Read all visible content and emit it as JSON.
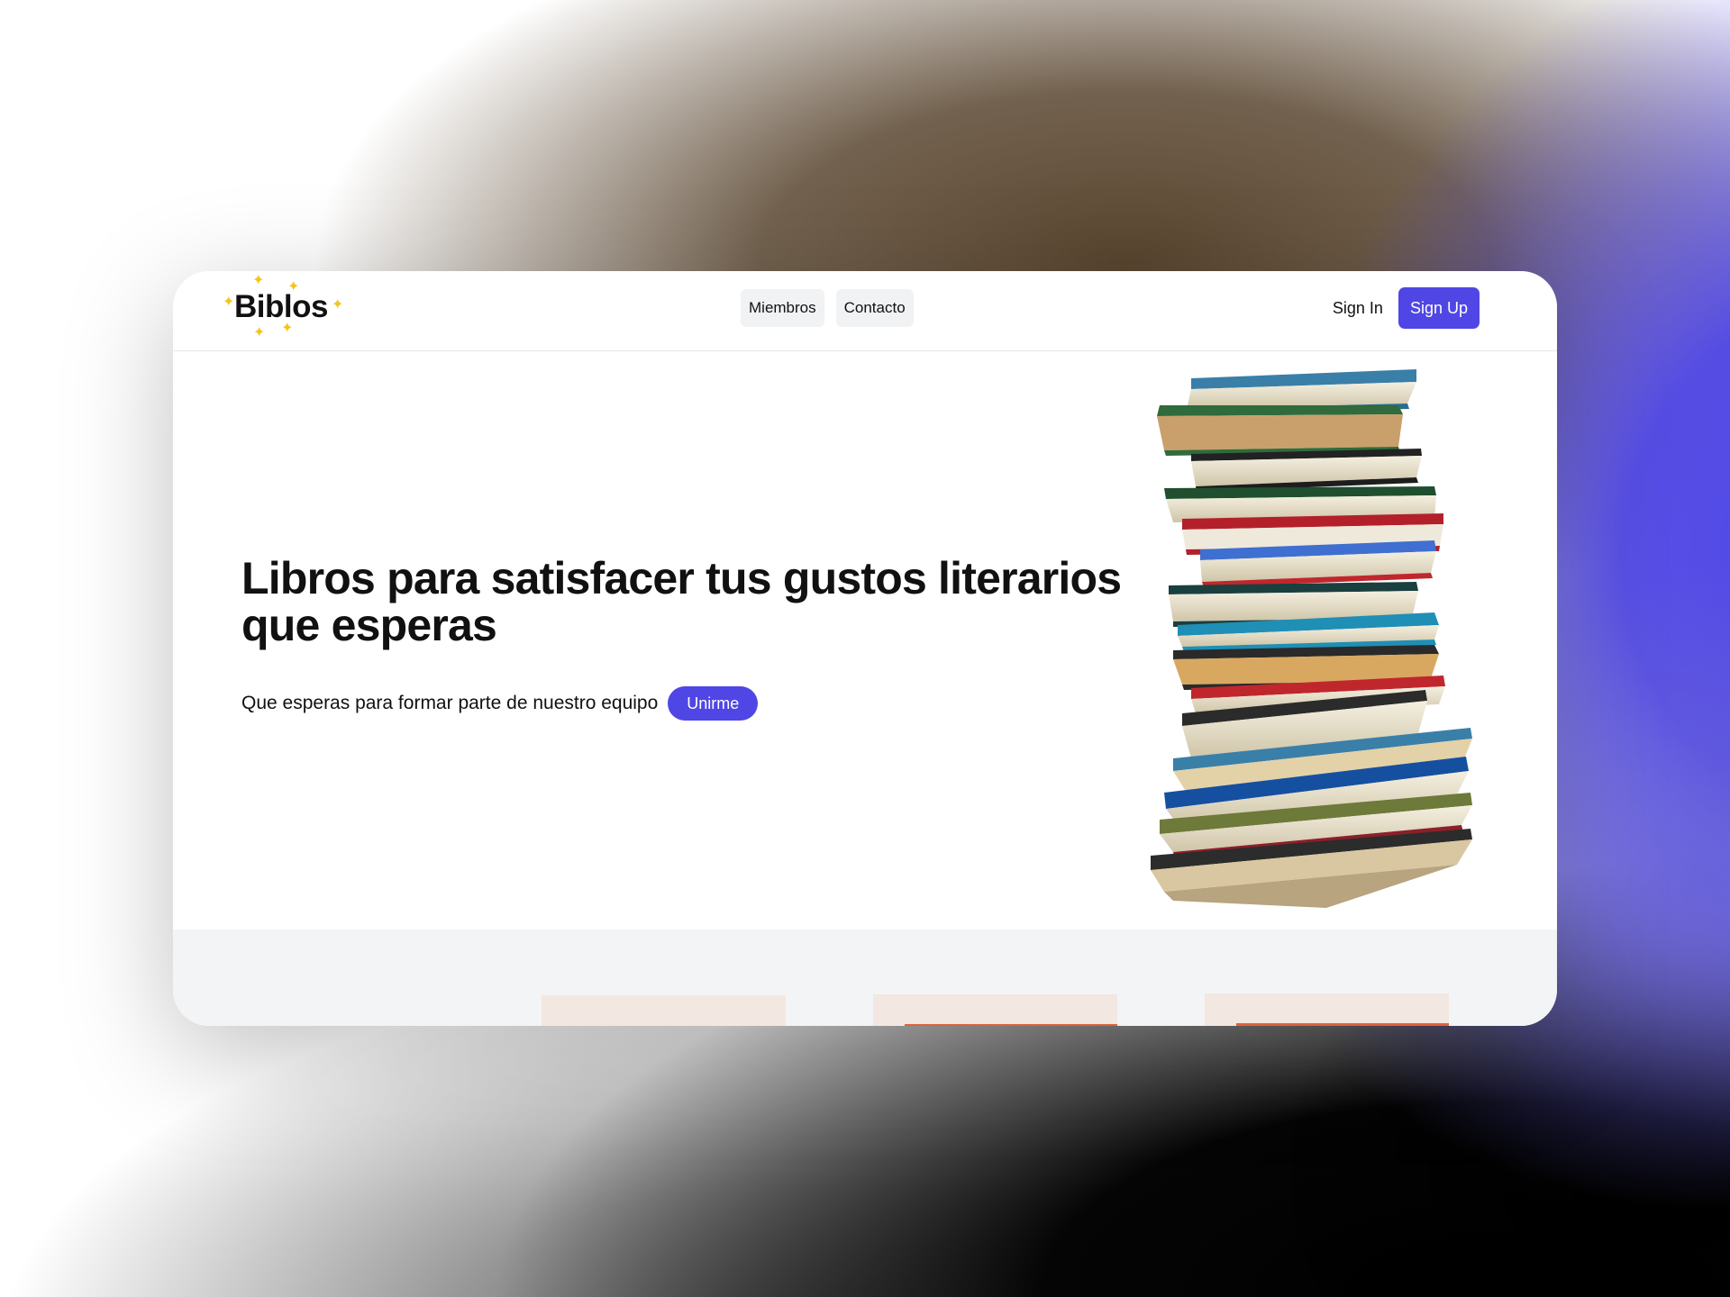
{
  "brand": {
    "name": "Biblos",
    "accent_color": "#4f46e5",
    "spark_color": "#f5c518"
  },
  "nav": {
    "items": [
      {
        "label": "Miembros"
      },
      {
        "label": "Contacto"
      }
    ]
  },
  "auth": {
    "sign_in_label": "Sign In",
    "sign_up_label": "Sign Up"
  },
  "hero": {
    "headline": "Libros para satisfacer tus gustos literarios que esperas",
    "subtext": "Que esperas para formar parte de nuestro equipo",
    "cta_label": "Unirme",
    "image": "stack-of-books"
  },
  "features": {
    "card_color": "#f2e8e1",
    "stripe_color": "#e0603a"
  }
}
